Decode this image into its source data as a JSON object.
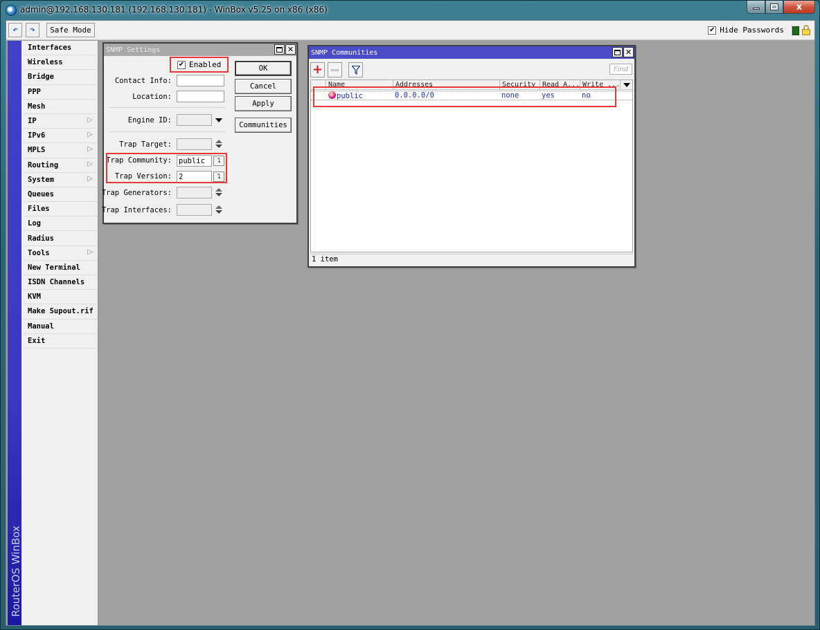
{
  "window": {
    "title": "admin@192.168.130.181 (192.168.130.181) - WinBox v5.25 on x86 (x86)",
    "close_glyph": "x"
  },
  "toolbar": {
    "undo_icon": "↶",
    "redo_icon": "↷",
    "safe_mode_label": "Safe Mode",
    "hide_passwords_label": "Hide Passwords",
    "hide_passwords_checked": true,
    "check_glyph": "✔",
    "status_color": "#1e6b1e"
  },
  "sidebar": {
    "brand": "RouterOS WinBox",
    "items": [
      {
        "label": "Interfaces",
        "submenu": false
      },
      {
        "label": "Wireless",
        "submenu": false
      },
      {
        "label": "Bridge",
        "submenu": false
      },
      {
        "label": "PPP",
        "submenu": false
      },
      {
        "label": "Mesh",
        "submenu": false
      },
      {
        "label": "IP",
        "submenu": true
      },
      {
        "label": "IPv6",
        "submenu": true
      },
      {
        "label": "MPLS",
        "submenu": true
      },
      {
        "label": "Routing",
        "submenu": true
      },
      {
        "label": "System",
        "submenu": true
      },
      {
        "label": "Queues",
        "submenu": false
      },
      {
        "label": "Files",
        "submenu": false
      },
      {
        "label": "Log",
        "submenu": false
      },
      {
        "label": "Radius",
        "submenu": false
      },
      {
        "label": "Tools",
        "submenu": true
      },
      {
        "label": "New Terminal",
        "submenu": false
      },
      {
        "label": "ISDN Channels",
        "submenu": false
      },
      {
        "label": "KVM",
        "submenu": false
      },
      {
        "label": "Make Supout.rif",
        "submenu": false
      },
      {
        "label": "Manual",
        "submenu": false
      },
      {
        "label": "Exit",
        "submenu": false
      }
    ],
    "submenu_glyph": "▷"
  },
  "snmp_settings": {
    "title": "SNMP Settings",
    "enabled_label": "Enabled",
    "enabled_checked": true,
    "fields": {
      "contact_info": {
        "label": "Contact Info:",
        "value": ""
      },
      "location": {
        "label": "Location:",
        "value": ""
      },
      "engine_id": {
        "label": "Engine ID:",
        "value": ""
      },
      "trap_target": {
        "label": "Trap Target:",
        "value": ""
      },
      "trap_community": {
        "label": "Trap Community:",
        "value": "public"
      },
      "trap_version": {
        "label": "Trap Version:",
        "value": "2"
      },
      "trap_generators": {
        "label": "Trap Generators:",
        "value": ""
      },
      "trap_interfaces": {
        "label": "Trap Interfaces:",
        "value": ""
      }
    },
    "buttons": {
      "ok": "OK",
      "cancel": "Cancel",
      "apply": "Apply",
      "communities": "Communities"
    },
    "dropdown_glyph": "⮧"
  },
  "snmp_communities": {
    "title": "SNMP Communities",
    "find_placeholder": "Find",
    "add_glyph": "+",
    "columns": [
      "Name",
      "Addresses",
      "Security",
      "Read A...",
      "Write ..."
    ],
    "rows": [
      {
        "name": "public",
        "addresses": "0.0.0.0/0",
        "security": "none",
        "read_access": "yes",
        "write_access": "no"
      }
    ],
    "row_marker": "›",
    "status": "1 item"
  },
  "colors": {
    "highlight": "#e8373a",
    "active_title": "#4a4cc6",
    "link_text": "#1c2fc9",
    "add_icon": "#d41a1a"
  }
}
